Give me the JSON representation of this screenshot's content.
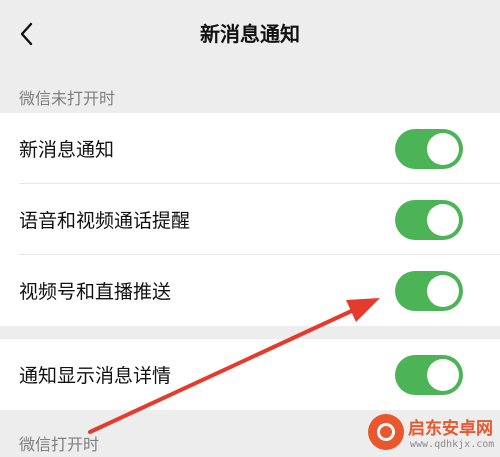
{
  "header": {
    "title": "新消息通知",
    "back_icon": "chevron-left-icon"
  },
  "sections": [
    {
      "label": "微信未打开时",
      "rows": [
        {
          "label": "新消息通知",
          "on": true
        },
        {
          "label": "语音和视频通话提醒",
          "on": true
        },
        {
          "label": "视频号和直播推送",
          "on": true
        }
      ]
    },
    {
      "rows": [
        {
          "label": "通知显示消息详情",
          "on": true
        }
      ]
    },
    {
      "label": "微信打开时"
    }
  ],
  "colors": {
    "toggle_on": "#4cb356",
    "arrow": "#e53b2c",
    "background": "#ededed"
  },
  "watermark": {
    "title": "启东安卓网",
    "url": "www.qdhkjx.com"
  }
}
